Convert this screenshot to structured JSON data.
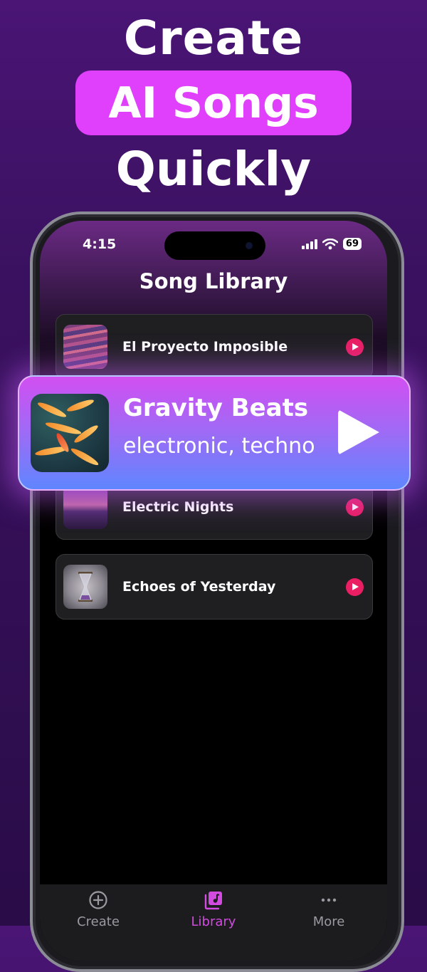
{
  "promo": {
    "line1": "Create",
    "line2": "AI Songs",
    "line3": "Quickly",
    "accent_color": "#e040fb"
  },
  "status_bar": {
    "time": "4:15",
    "battery": "69"
  },
  "library": {
    "title": "Song Library",
    "songs": [
      {
        "title": "El Proyecto Imposible"
      },
      {
        "title": "Electric Nights"
      },
      {
        "title": "Echoes of Yesterday"
      }
    ]
  },
  "featured": {
    "title": "Gravity Beats",
    "genre": "electronic, techno"
  },
  "tabs": [
    {
      "label": "Create",
      "icon": "plus-circle-icon"
    },
    {
      "label": "Library",
      "icon": "music-library-icon",
      "active": true
    },
    {
      "label": "More",
      "icon": "more-dots-icon"
    }
  ],
  "colors": {
    "play_button": "#e91e63",
    "active_tab": "#d24be0"
  }
}
